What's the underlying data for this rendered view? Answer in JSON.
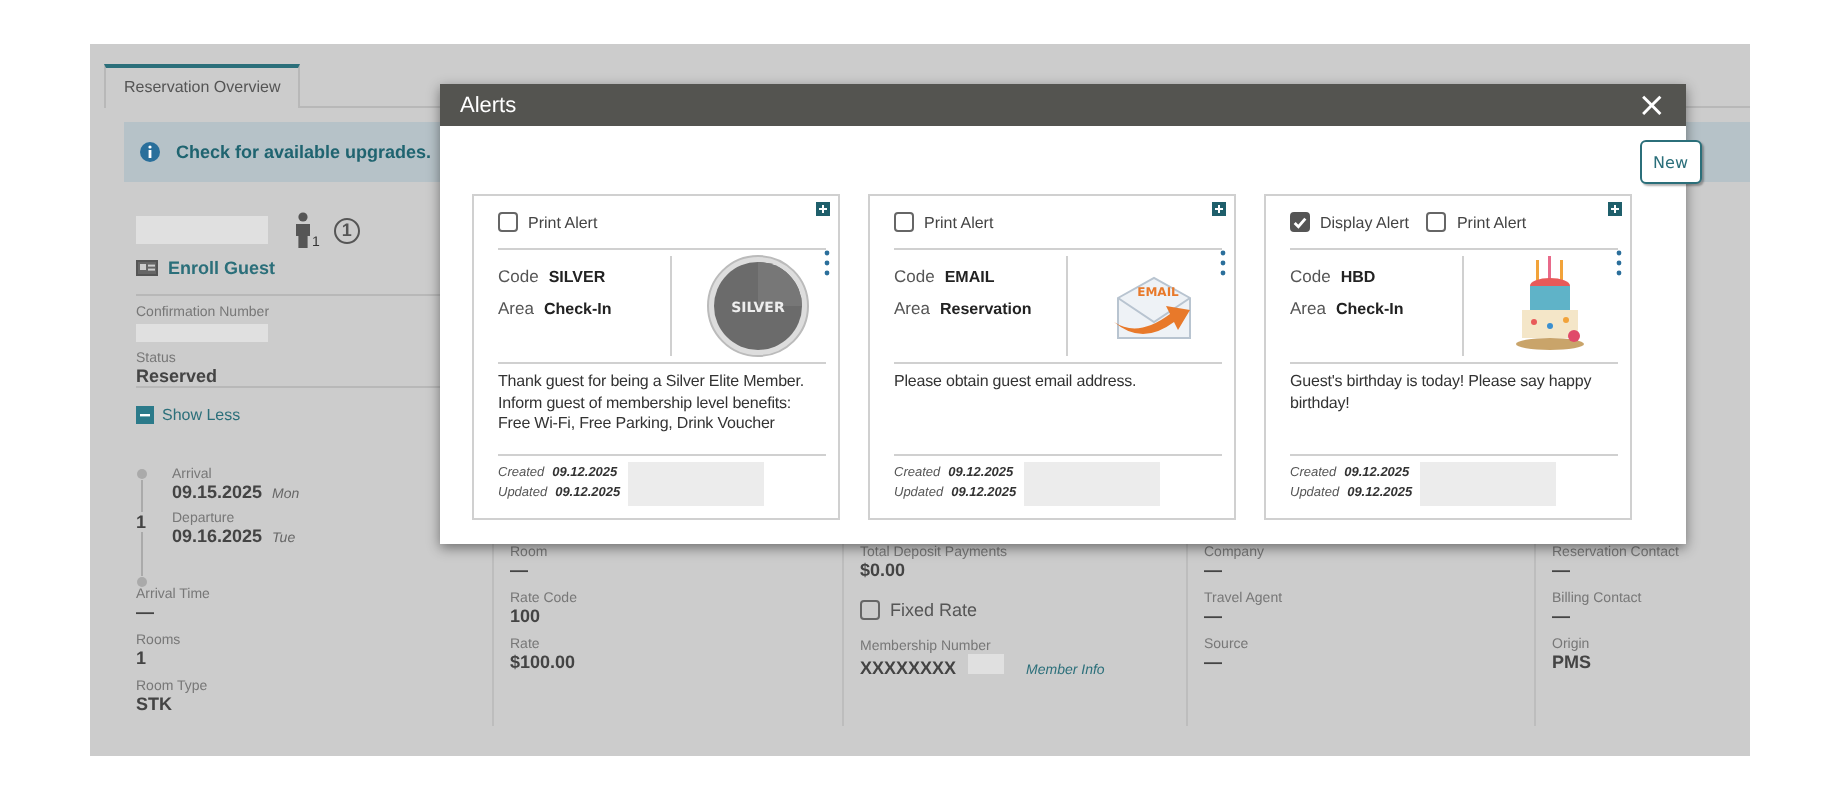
{
  "reservation": {
    "tab": {
      "label": "Reservation Overview",
      "selected": true
    },
    "banner": "Check for available upgrades.",
    "guest": {
      "adults": "1",
      "badge": "1",
      "enroll_link": "Enroll Guest"
    },
    "confirmation_label": "Confirmation Number",
    "status": {
      "label": "Status",
      "value": "Reserved"
    },
    "toggle": {
      "label": "Show Less",
      "expanded": true
    },
    "stay": {
      "arrival_label": "Arrival",
      "arrival_date": "09.15.2025",
      "arrival_day": "Mon",
      "nights": "1",
      "departure_label": "Departure",
      "departure_date": "09.16.2025",
      "departure_day": "Tue"
    },
    "columns": [
      [
        {
          "kind": "field",
          "label": "Arrival Time",
          "value": "—"
        },
        {
          "kind": "field",
          "label": "Rooms",
          "value": "1"
        },
        {
          "kind": "field",
          "label": "Room Type",
          "value": "STK"
        }
      ],
      [
        {
          "kind": "field",
          "label": "Room",
          "value": "—"
        },
        {
          "kind": "field",
          "label": "Rate Code",
          "value": "100"
        },
        {
          "kind": "field",
          "label": "Rate",
          "value": "$100.00"
        }
      ],
      [
        {
          "kind": "field",
          "label": "Total Deposit Payments",
          "value": "$0.00"
        },
        {
          "kind": "checkbox",
          "label": "Fixed Rate",
          "checked": false
        },
        {
          "kind": "membership",
          "label": "Membership Number",
          "value": "XXXXXXXX",
          "link": "Member Info"
        }
      ],
      [
        {
          "kind": "field",
          "label": "Company",
          "value": "—"
        },
        {
          "kind": "field",
          "label": "Travel Agent",
          "value": "—"
        },
        {
          "kind": "field",
          "label": "Source",
          "value": "—"
        }
      ],
      [
        {
          "kind": "field",
          "label": "Reservation Contact",
          "value": "—"
        },
        {
          "kind": "field",
          "label": "Billing Contact",
          "value": "—"
        },
        {
          "kind": "field",
          "label": "Origin",
          "value": "PMS"
        }
      ]
    ]
  },
  "alerts_dialog": {
    "title": "Alerts",
    "close": "×",
    "new_button": "New",
    "alerts": [
      {
        "options": [
          {
            "label": "Print Alert",
            "checked": false
          }
        ],
        "code_label": "Code",
        "code": "SILVER",
        "area_label": "Area",
        "area": "Check-In",
        "kind": "badge",
        "image_text": "SILVER",
        "message": "Thank guest for being a Silver Elite Member. Inform guest of membership level benefits: Free Wi-Fi, Free Parking, Drink Voucher",
        "created_label": "Created",
        "created": "09.12.2025",
        "updated_label": "Updated",
        "updated": "09.12.2025"
      },
      {
        "options": [
          {
            "label": "Print Alert",
            "checked": false
          }
        ],
        "code_label": "Code",
        "code": "EMAIL",
        "area_label": "Area",
        "area": "Reservation",
        "kind": "envelope",
        "image_text": "EMAIL",
        "message": "Please obtain guest email address.",
        "created_label": "Created",
        "created": "09.12.2025",
        "updated_label": "Updated",
        "updated": "09.12.2025"
      },
      {
        "options": [
          {
            "label": "Display Alert",
            "checked": true
          },
          {
            "label": "Print Alert",
            "checked": false
          }
        ],
        "code_label": "Code",
        "code": "HBD",
        "area_label": "Area",
        "area": "Check-In",
        "kind": "cake",
        "message": "Guest's birthday is today! Please say happy birthday!",
        "created_label": "Created",
        "created": "09.12.2025",
        "updated_label": "Updated",
        "updated": "09.12.2025"
      }
    ]
  }
}
